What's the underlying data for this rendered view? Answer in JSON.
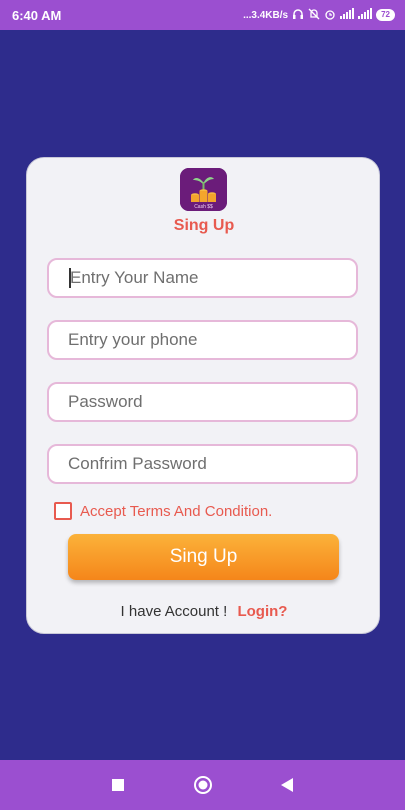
{
  "status_bar": {
    "time": "6:40 AM",
    "network_speed": "...3.4KB/s",
    "battery": "72",
    "icons": [
      "headphones-icon",
      "mute-icon",
      "alarm-icon",
      "signal-icon",
      "signal-icon",
      "battery-icon"
    ]
  },
  "form": {
    "title": "Sing Up",
    "name_placeholder": "Entry Your Name",
    "phone_placeholder": "Entry your phone",
    "password_placeholder": "Password",
    "confirm_placeholder": "Confrim Password",
    "terms_label": "Accept Terms And Condition.",
    "terms_checked": false,
    "signup_label": "Sing Up",
    "have_account": "I have Account !",
    "login_label": "Login?"
  },
  "logo": {
    "text": "Cash $$",
    "icon": "coins-plant-icon"
  },
  "nav_bar": {
    "icons": [
      "recents-square-icon",
      "home-circle-icon",
      "back-triangle-icon"
    ]
  },
  "colors": {
    "background": "#2e2c8c",
    "bars": "#9b4fd0",
    "accent": "#e85a4f",
    "button_top": "#fbb23a",
    "button_bottom": "#f5861a",
    "field_border": "#e6b8d9"
  }
}
